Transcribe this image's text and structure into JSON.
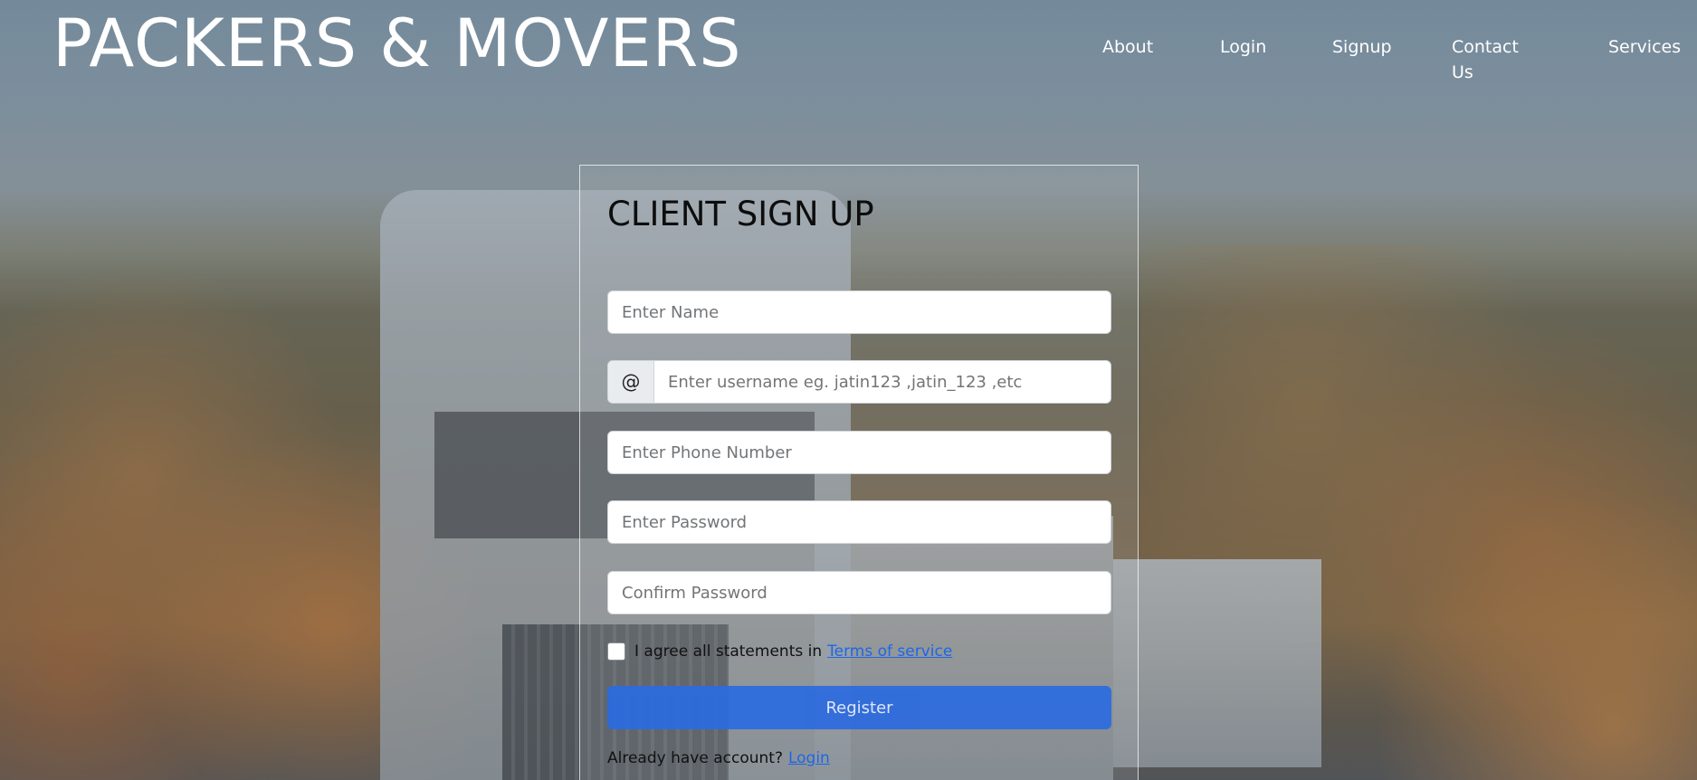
{
  "header": {
    "brand": "PACKERS & MOVERS",
    "nav": [
      {
        "label": "About"
      },
      {
        "label": "Login"
      },
      {
        "label": "Signup"
      },
      {
        "label": "Contact Us"
      },
      {
        "label": "Services"
      }
    ]
  },
  "form": {
    "title": "CLIENT SIGN UP",
    "name_placeholder": "Enter Name",
    "username_addon": "@",
    "username_placeholder": "Enter username eg. jatin123 ,jatin_123 ,etc",
    "phone_placeholder": "Enter Phone Number",
    "password_placeholder": "Enter Password",
    "confirm_placeholder": "Confirm Password",
    "agree_text": "I agree all statements in",
    "terms_link": "Terms of service",
    "register_label": "Register",
    "already_text": "Already have account?",
    "login_link": "Login"
  },
  "colors": {
    "accent": "#2b6be0",
    "link": "#1e66e8"
  }
}
